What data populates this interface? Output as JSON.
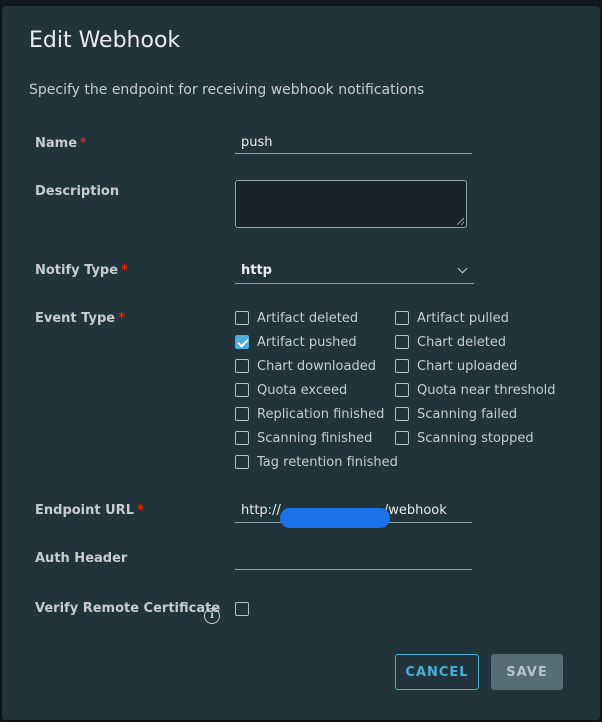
{
  "dialog": {
    "title": "Edit Webhook",
    "subtitle": "Specify the endpoint for receiving webhook notifications"
  },
  "form": {
    "name": {
      "label": "Name",
      "required": "*",
      "value": "push"
    },
    "description": {
      "label": "Description",
      "value": ""
    },
    "notify_type": {
      "label": "Notify Type",
      "required": "*",
      "value": "http"
    },
    "event_type": {
      "label": "Event Type",
      "required": "*",
      "options": [
        {
          "label": "Artifact deleted",
          "checked": false
        },
        {
          "label": "Artifact pulled",
          "checked": false
        },
        {
          "label": "Artifact pushed",
          "checked": true
        },
        {
          "label": "Chart deleted",
          "checked": false
        },
        {
          "label": "Chart downloaded",
          "checked": false
        },
        {
          "label": "Chart uploaded",
          "checked": false
        },
        {
          "label": "Quota exceed",
          "checked": false
        },
        {
          "label": "Quota near threshold",
          "checked": false
        },
        {
          "label": "Replication finished",
          "checked": false
        },
        {
          "label": "Scanning failed",
          "checked": false
        },
        {
          "label": "Scanning finished",
          "checked": false
        },
        {
          "label": "Scanning stopped",
          "checked": false
        },
        {
          "label": "Tag retention finished",
          "checked": false
        }
      ]
    },
    "endpoint_url": {
      "label": "Endpoint URL",
      "required": "*",
      "value_prefix": "http://",
      "value_suffix": "/webhook"
    },
    "auth_header": {
      "label": "Auth Header",
      "value": ""
    },
    "verify_cert": {
      "label": "Verify Remote Certificate",
      "checked": false
    }
  },
  "footer": {
    "cancel_label": "CANCEL",
    "save_label": "SAVE"
  },
  "icons": {
    "info": "info-icon",
    "chevron": "chevron-down-icon"
  },
  "colors": {
    "accent": "#49afd9",
    "required": "#e62700",
    "background": "#21333b"
  }
}
